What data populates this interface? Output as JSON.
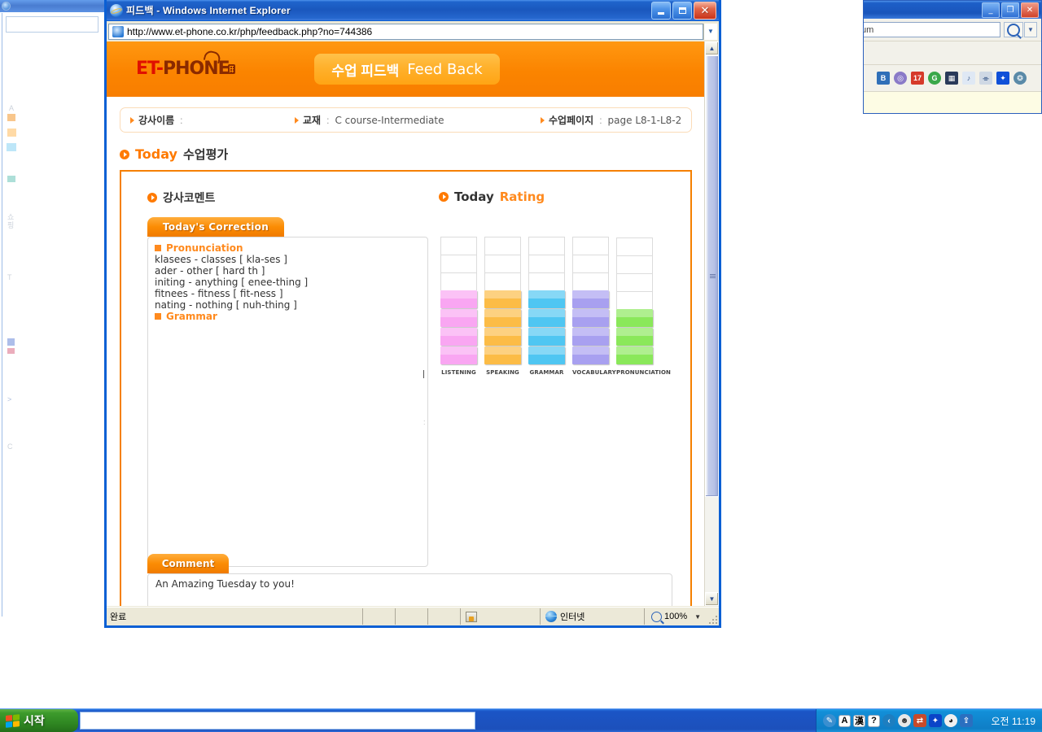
{
  "background_window_left": {
    "ghost_labels": [
      "A",
      "T",
      "C"
    ]
  },
  "background_window_right": {
    "search_value": "um",
    "search_icon": "magnifier-icon",
    "dropdown_icon": "chevron-down-icon",
    "close_note_icon": "close-icon",
    "minimize_label": "_",
    "restore_label": "❐",
    "close_label": "✕",
    "toolbar_icons": [
      "bb-icon",
      "compass-icon",
      "calendar-icon",
      "g-icon",
      "photo-icon",
      "music-icon",
      "flashlight-icon",
      "bluetooth-icon",
      "share-icon"
    ]
  },
  "browser": {
    "title": "피드백 - Windows Internet Explorer",
    "title_icon": "internet-explorer-icon",
    "minimize_label": "_",
    "restore_label": "❐",
    "close_label": "✕",
    "address": {
      "icon": "page-icon",
      "value": "http://www.et-phone.co.kr/php/feedback.php?no=744386",
      "dropdown_icon": "chevron-down-icon"
    },
    "scrollbar": {
      "up_icon": "▲",
      "down_icon": "▼"
    },
    "status": {
      "state": "완료",
      "security_icon": "security-report-icon",
      "zone_icon": "globe-icon",
      "zone": "인터넷",
      "zoom_icon": "magnifier-icon",
      "zoom": "100%",
      "zoom_dropdown_icon": "chevron-down-icon"
    }
  },
  "site": {
    "logo": {
      "et": "ET",
      "dot": "-",
      "phone": "PHONE"
    },
    "header_badge": {
      "korean": "수업 피드백",
      "english": "Feed Back"
    },
    "breadcrumb": [
      {
        "label": "강사이름",
        "sep": ":",
        "value": ""
      },
      {
        "label": "교재",
        "sep": ":",
        "value": "C course-Intermediate"
      },
      {
        "label": "수업페이지",
        "sep": ":",
        "value": "page L8-1-L8-2"
      }
    ],
    "section_title": {
      "en": "Today",
      "kr": "수업평가"
    },
    "left": {
      "heading": "강사코멘트",
      "tab_label": "Today's Correction",
      "correction": {
        "group1_title": "Pronunciation",
        "lines": [
          "klasees - classes [ kla-ses ]",
          "ader - other [ hard th ]",
          "initing - anything [ enee-thing ]",
          "fitnees - fitness [ fit-ness ]",
          "nating - nothing [ nuh-thing ]"
        ],
        "group2_title": "Grammar"
      }
    },
    "right": {
      "heading_en": "Today",
      "heading_accent": "Rating"
    },
    "comment": {
      "tab_label": "Comment",
      "text": "An Amazing Tuesday to you!"
    }
  },
  "chart_data": {
    "type": "bar",
    "title": "Today Rating",
    "categories": [
      "LISTENING",
      "SPEAKING",
      "GRAMMAR",
      "VOCABULARY",
      "PRONUNCIATION"
    ],
    "values": [
      4,
      4,
      4,
      4,
      3
    ],
    "max": 7,
    "colors": [
      "#f9a6f2",
      "#fcbc46",
      "#4fc6f2",
      "#a8a0f0",
      "#8ae85a"
    ],
    "xlabel": "",
    "ylabel": "",
    "ylim": [
      0,
      7
    ],
    "grid": true,
    "legend": "none"
  },
  "taskbar": {
    "start_label": "시작",
    "start_icon": "windows-flag-icon",
    "tray_icons": [
      "paint-icon",
      "ime-a-icon",
      "ime-hanja-icon",
      "ime-help-icon",
      "messenger-icon",
      "speaker-icon",
      "network-icon",
      "bluetooth-icon",
      "antivirus-icon",
      "update-icon"
    ],
    "ime_a": "A",
    "ime_hanja": "漢",
    "ime_help": "?",
    "clock": "오전 11:19"
  }
}
